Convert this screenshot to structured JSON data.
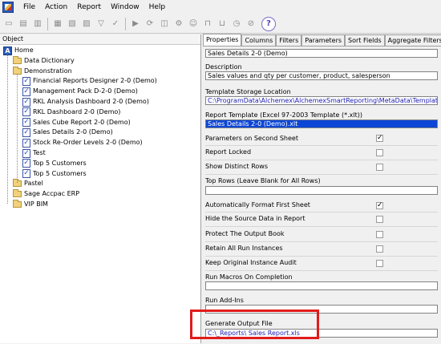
{
  "menu": [
    "File",
    "Action",
    "Report",
    "Window",
    "Help"
  ],
  "toolbar": {
    "icons": [
      "new-report-icon",
      "delete-icon",
      "copy-icon",
      "edit-icon",
      "open-icon",
      "print-icon",
      "filter-icon",
      "check-icon",
      "run-icon",
      "refresh-icon",
      "stop-icon",
      "settings-icon",
      "person-icon",
      "lock-icon",
      "lock-open-icon",
      "schedule-icon",
      "cancel-icon",
      "help-icon"
    ],
    "help_glyph": "?"
  },
  "tree": {
    "header": "Object",
    "items": [
      {
        "label": "Home",
        "type": "home",
        "level": 0
      },
      {
        "label": "Data Dictionary",
        "type": "folder",
        "level": 1
      },
      {
        "label": "Demonstration",
        "type": "folder",
        "level": 1
      },
      {
        "label": "Financial Reports Designer 2-0 (Demo)",
        "type": "report",
        "level": 2
      },
      {
        "label": "Management Pack D-2-0 (Demo)",
        "type": "report",
        "level": 2
      },
      {
        "label": "RKL Analysis Dashboard 2-0 (Demo)",
        "type": "report",
        "level": 2
      },
      {
        "label": "RKL Dashboard 2-0 (Demo)",
        "type": "report",
        "level": 2
      },
      {
        "label": "Sales Cube Report 2-0 (Demo)",
        "type": "report",
        "level": 2
      },
      {
        "label": "Sales Details 2-0 (Demo)",
        "type": "report",
        "level": 2
      },
      {
        "label": "Stock Re-Order Levels 2-0 (Demo)",
        "type": "report",
        "level": 2
      },
      {
        "label": "Test",
        "type": "report",
        "level": 2
      },
      {
        "label": "Top 5 Customers",
        "type": "report",
        "level": 2
      },
      {
        "label": "Top 5 Customers",
        "type": "report",
        "level": 2
      },
      {
        "label": "Pastel",
        "type": "folder",
        "level": 1
      },
      {
        "label": "Sage Accpac ERP",
        "type": "folder",
        "level": 1
      },
      {
        "label": "VIP BIM",
        "type": "folder",
        "level": 1
      }
    ]
  },
  "tabs": [
    "Properties",
    "Columns",
    "Filters",
    "Parameters",
    "Sort Fields",
    "Aggregate Filters"
  ],
  "properties": {
    "name_value": "Sales Details 2-0 (Demo)",
    "description_label": "Description",
    "description_value": "Sales values and qty per customer, product, salesperson",
    "storage_label": "Template Storage Location",
    "storage_value": "C:\\ProgramData\\Alchemex\\AlchemexSmartReporting\\MetaData\\Templates\\",
    "template_label": "Report Template (Excel 97-2003 Template (*.xlt))",
    "template_value": "Sales Details 2-0 (Demo).xlt",
    "params_second_sheet_label": "Parameters on Second Sheet",
    "params_second_sheet_checked": "✓",
    "report_locked_label": "Report Locked",
    "show_distinct_label": "Show Distinct Rows",
    "top_rows_label": "Top Rows (Leave Blank for All Rows)",
    "auto_format_label": "Automatically Format First Sheet",
    "auto_format_checked": "✓",
    "hide_source_label": "Hide the Source Data in Report",
    "protect_output_label": "Protect The Output Book",
    "retain_instances_label": "Retain All Run Instances",
    "keep_audit_label": "Keep Original Instance Audit",
    "run_macros_label": "Run Macros On Completion",
    "run_addins_label": "Run Add-Ins",
    "generate_output_label": "Generate Output File",
    "generate_output_value": "C:\\_Reports\\ Sales Report.xls"
  },
  "colors": {
    "highlight": "#0c46d6",
    "annotation": "#e11b1b"
  }
}
